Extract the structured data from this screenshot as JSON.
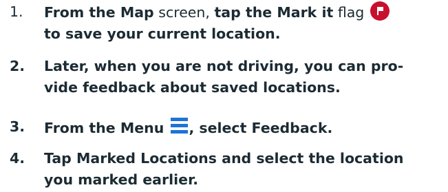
{
  "steps": [
    {
      "number": "1.",
      "lines": [
        {
          "parts": [
            {
              "text": "From the ",
              "style": "bold"
            },
            {
              "text": "Map",
              "style": "bold"
            },
            {
              "text": " screen, ",
              "style": "reg"
            },
            {
              "text": "tap the ",
              "style": "bold"
            },
            {
              "text": "Mark it",
              "style": "bold"
            },
            {
              "text": " flag ",
              "style": "reg"
            }
          ]
        },
        {
          "parts": [
            {
              "text": "to save your current location.",
              "style": "bold"
            }
          ]
        }
      ]
    },
    {
      "number": "2.",
      "lines": [
        {
          "parts": [
            {
              "text": "Later, when you are not driving, you can  pro-",
              "style": "bold"
            }
          ]
        },
        {
          "parts": [
            {
              "text": "vide feedback about saved locations.",
              "style": "bold"
            }
          ]
        }
      ]
    },
    {
      "number": "3.",
      "lines": [
        {
          "parts": [
            {
              "text": "From the Menu ",
              "style": "bold"
            },
            {
              "text": ", select ",
              "style": "bold"
            },
            {
              "text": "Feedback",
              "style": "bold"
            },
            {
              "text": ".",
              "style": "bold"
            }
          ]
        }
      ]
    },
    {
      "number": "4.",
      "lines": [
        {
          "parts": [
            {
              "text": "Tap ",
              "style": "bold"
            },
            {
              "text": "Marked Locations",
              "style": "bold"
            },
            {
              "text": " and select the location",
              "style": "bold"
            }
          ]
        },
        {
          "parts": [
            {
              "text": "you marked earlier.",
              "style": "bold"
            }
          ]
        }
      ]
    }
  ],
  "icons": {
    "flag": "mark-it-flag-icon",
    "menu": "menu-icon"
  },
  "colors": {
    "text": "#1c2b33",
    "flag_background": "#c8102e",
    "menu_icon": "#1e73d6"
  }
}
